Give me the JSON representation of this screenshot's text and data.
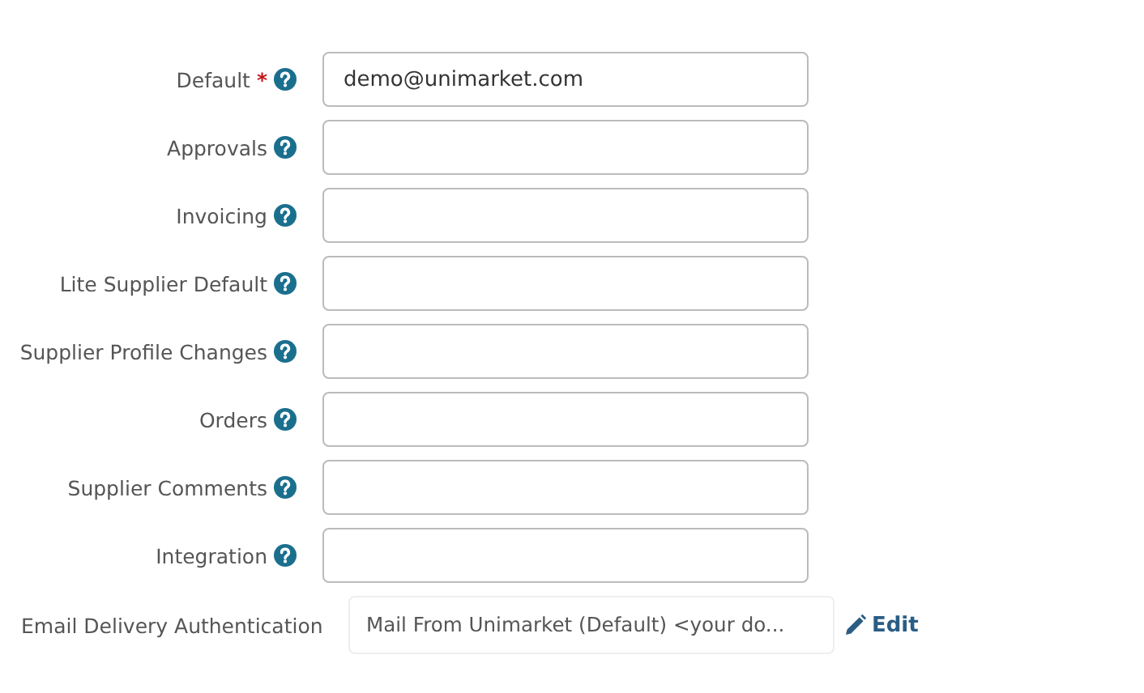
{
  "email_fields": [
    {
      "label": "Default",
      "required_mark": "*",
      "value": "demo@unimarket.com"
    },
    {
      "label": "Approvals"
    },
    {
      "label": "Invoicing"
    },
    {
      "label": "Lite Supplier Default"
    },
    {
      "label": "Supplier Profile Changes"
    },
    {
      "label": "Orders"
    },
    {
      "label": "Supplier Comments"
    },
    {
      "label": "Integration"
    }
  ],
  "email_delivery_authentication": {
    "label": "Email Delivery Authentication",
    "value": "Mail From Unimarket (Default) <your do...",
    "edit_link": "Edit"
  }
}
